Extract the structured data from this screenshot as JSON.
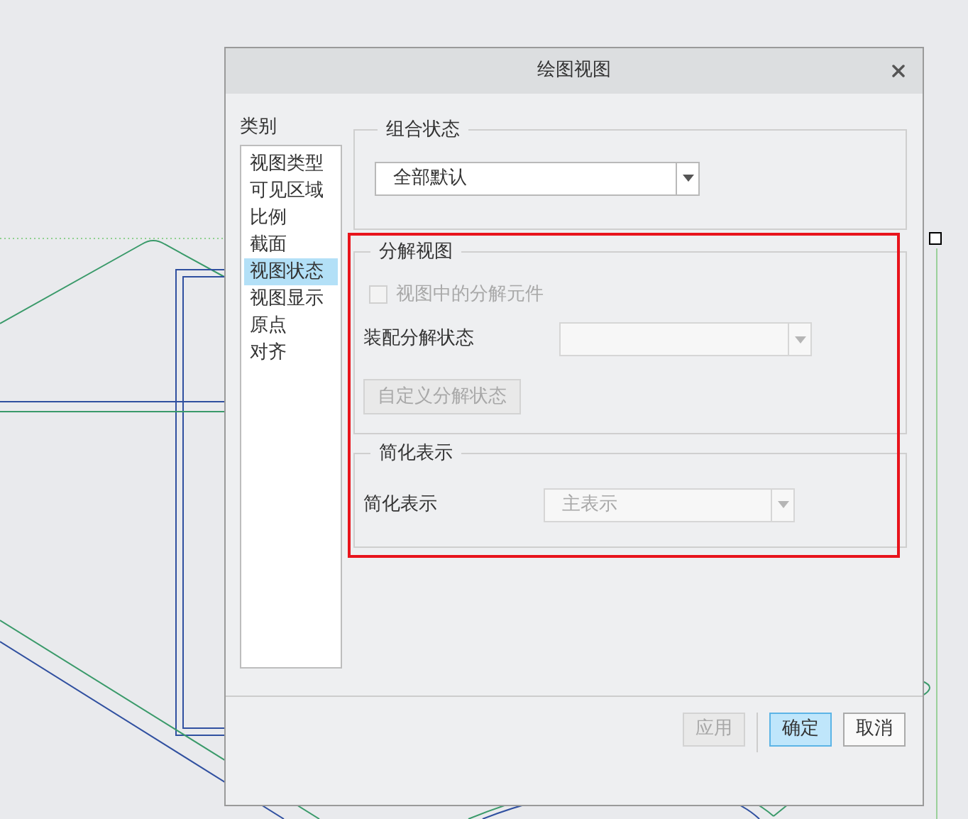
{
  "dialog": {
    "title": "绘图视图",
    "category_label": "类别",
    "categories": [
      {
        "label": "视图类型",
        "selected": false
      },
      {
        "label": "可见区域",
        "selected": false
      },
      {
        "label": "比例",
        "selected": false
      },
      {
        "label": "截面",
        "selected": false
      },
      {
        "label": "视图状态",
        "selected": true
      },
      {
        "label": "视图显示",
        "selected": false
      },
      {
        "label": "原点",
        "selected": false
      },
      {
        "label": "对齐",
        "selected": false
      }
    ],
    "combination_state": {
      "label": "组合状态",
      "value": "全部默认"
    },
    "explode_view": {
      "label": "分解视图",
      "checkbox": {
        "label": "视图中的分解元件",
        "checked": false,
        "disabled": true
      },
      "assembly_explode_state": {
        "label": "装配分解状态",
        "disabled": true
      },
      "custom_button": {
        "label": "自定义分解状态",
        "disabled": true
      }
    },
    "simplified_rep": {
      "label": "简化表示",
      "field_label": "简化表示",
      "value": "主表示",
      "disabled": true
    },
    "buttons": [
      {
        "label": "应用",
        "disabled": true,
        "default": false
      },
      {
        "label": "确定",
        "disabled": false,
        "default": true
      },
      {
        "label": "取消",
        "disabled": false,
        "default": false
      }
    ]
  }
}
